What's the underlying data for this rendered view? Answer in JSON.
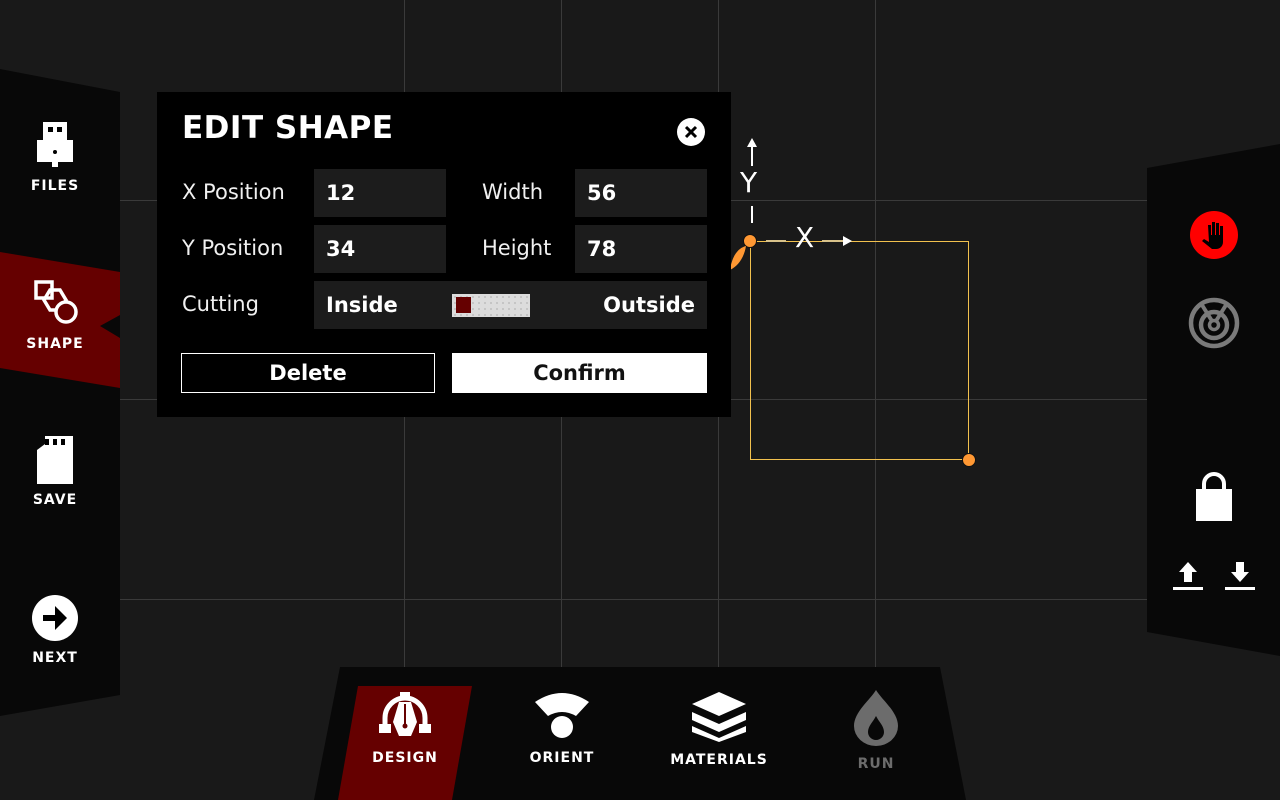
{
  "sidebar": {
    "items": [
      {
        "label": "FILES",
        "icon": "usb-drive-icon"
      },
      {
        "label": "SHAPE",
        "icon": "shapes-icon",
        "active": true
      },
      {
        "label": "SAVE",
        "icon": "sd-card-icon"
      },
      {
        "label": "NEXT",
        "icon": "arrow-right-circle-icon"
      }
    ]
  },
  "bottom_nav": {
    "items": [
      {
        "label": "DESIGN",
        "icon": "pen-tool-icon",
        "active": true
      },
      {
        "label": "ORIENT",
        "icon": "orient-icon"
      },
      {
        "label": "MATERIALS",
        "icon": "layers-icon"
      },
      {
        "label": "RUN",
        "icon": "flame-icon",
        "disabled": true
      }
    ]
  },
  "right_tools": {
    "items": [
      {
        "icon": "stop-hand-icon",
        "color": "#ff0000"
      },
      {
        "icon": "target-icon",
        "color": "#7a7a7a"
      },
      {
        "icon": "lock-icon"
      },
      {
        "icon": "upload-icon"
      },
      {
        "icon": "download-icon"
      }
    ]
  },
  "dialog": {
    "title": "EDIT SHAPE",
    "fields": {
      "x_label": "X Position",
      "x_value": "12",
      "y_label": "Y Position",
      "y_value": "34",
      "width_label": "Width",
      "width_value": "56",
      "height_label": "Height",
      "height_value": "78"
    },
    "cutting": {
      "label": "Cutting",
      "option_left": "Inside",
      "option_right": "Outside",
      "selected": "Inside"
    },
    "delete_label": "Delete",
    "confirm_label": "Confirm"
  },
  "canvas": {
    "axis_x_label": "X",
    "axis_y_label": "Y",
    "shape_color": "#f2c14e",
    "handle_color": "#ff9833"
  },
  "colors": {
    "accent": "#650000",
    "background": "#191919",
    "panel": "#080808"
  }
}
